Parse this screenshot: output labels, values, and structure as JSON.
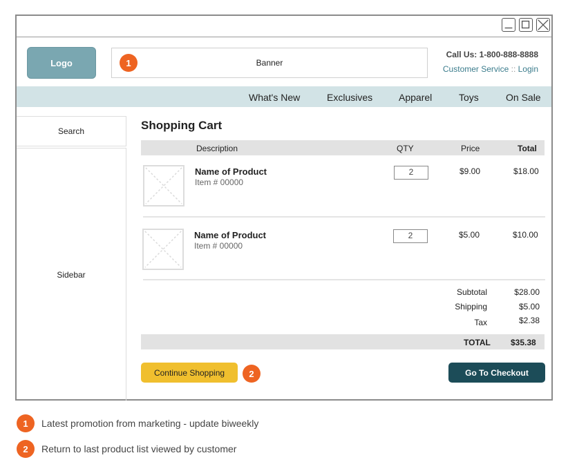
{
  "header": {
    "logo_label": "Logo",
    "banner_label": "Banner",
    "banner_badge": "1",
    "call_us": "Call Us: 1-800-888-8888",
    "customer_service": "Customer Service",
    "separator": "::",
    "login": "Login"
  },
  "nav": {
    "items": [
      "What's New",
      "Exclusives",
      "Apparel",
      "Toys",
      "On Sale"
    ]
  },
  "sidebar": {
    "search_label": "Search",
    "sidebar_label": "Sidebar"
  },
  "cart": {
    "title": "Shopping Cart",
    "columns": {
      "description": "Description",
      "qty": "QTY",
      "price": "Price",
      "total": "Total"
    },
    "rows": [
      {
        "name": "Name of Product",
        "item": "Item # 00000",
        "qty": "2",
        "price": "$9.00",
        "total": "$18.00"
      },
      {
        "name": "Name of Product",
        "item": "Item # 00000",
        "qty": "2",
        "price": "$5.00",
        "total": "$10.00"
      }
    ],
    "subtotal_label": "Subtotal",
    "subtotal_value": "$28.00",
    "shipping_label": "Shipping",
    "shipping_value": "$5.00",
    "tax_label": "Tax",
    "tax_value": "$2.38",
    "total_label": "TOTAL",
    "total_value": "$35.38",
    "continue_label": "Continue Shopping",
    "continue_badge": "2",
    "checkout_label": "Go To Checkout"
  },
  "notes": [
    {
      "badge": "1",
      "text": "Latest promotion from marketing - update biweekly"
    },
    {
      "badge": "2",
      "text": "Return to last product list viewed by customer"
    }
  ],
  "colors": {
    "accent_badge": "#ee6422",
    "logo_bg": "#7aa7b1",
    "nav_bg": "#d2e3e6",
    "continue_bg": "#f0bf2e",
    "checkout_bg": "#1c4c58",
    "link": "#3b7c8c"
  }
}
